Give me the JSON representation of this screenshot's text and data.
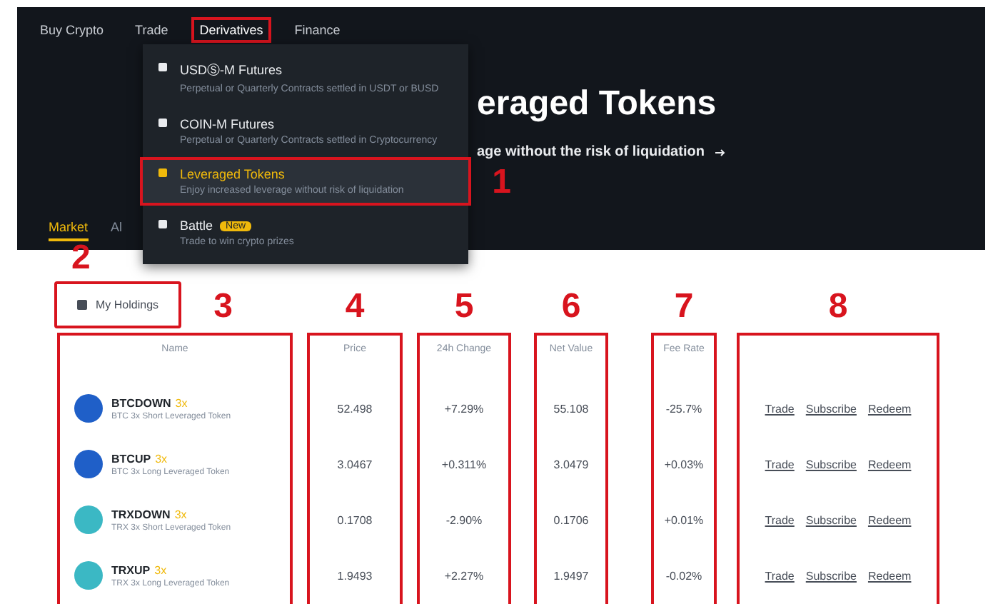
{
  "nav": {
    "items": [
      {
        "label": "Buy Crypto",
        "highlighted": false
      },
      {
        "label": "Trade",
        "highlighted": false
      },
      {
        "label": "Derivatives",
        "highlighted": true
      },
      {
        "label": "Finance",
        "highlighted": false
      }
    ]
  },
  "derivatives_menu": {
    "items": [
      {
        "title": "USDⓈ-M Futures",
        "description": "Perpetual or Quarterly Contracts settled in USDT or BUSD",
        "selected": false
      },
      {
        "title": "COIN-M Futures",
        "description": "Perpetual or Quarterly Contracts settled in Cryptocurrency",
        "selected": false
      },
      {
        "title": "Leveraged Tokens",
        "description": "Enjoy increased leverage without risk of liquidation",
        "selected": true,
        "annotation": "1"
      },
      {
        "title": "Battle",
        "description": "Trade to win crypto prizes",
        "selected": false,
        "badge": "New"
      }
    ]
  },
  "hero": {
    "title": "eraged Tokens",
    "subtitle": "age without the risk of liquidation"
  },
  "tabs": [
    {
      "label": "Market",
      "selected": true
    },
    {
      "label": "Al",
      "selected": false
    }
  ],
  "holdings_button": {
    "label": "My Holdings",
    "annotation": "2"
  },
  "token_table": {
    "sections": [
      {
        "header": "Name",
        "annotation": "3"
      },
      {
        "header": "Price",
        "annotation": "4"
      },
      {
        "header": "24h Change",
        "annotation": "5"
      },
      {
        "header": "Net Value",
        "annotation": "6"
      },
      {
        "header": "Fee Rate",
        "annotation": "7"
      },
      {
        "annotation": "8"
      }
    ],
    "tokens": [
      {
        "name": "BTCDOWN",
        "badge": "3x",
        "description": "BTC 3x Short Leveraged Token",
        "color": "#1f5fc8",
        "price": "52.498",
        "change": "+7.29%",
        "net_value": "55.108",
        "fee_rate": "-25.7%",
        "actions": [
          "Trade",
          "Subscribe",
          "Redeem"
        ]
      },
      {
        "name": "BTCUP",
        "badge": "3x",
        "description": "BTC 3x Long Leveraged Token",
        "color": "#1f5fc8",
        "price": "3.0467",
        "change": "+0.311%",
        "net_value": "3.0479",
        "fee_rate": "+0.03%",
        "actions": [
          "Trade",
          "Subscribe",
          "Redeem"
        ]
      },
      {
        "name": "TRXDOWN",
        "badge": "3x",
        "description": "TRX 3x Short Leveraged Token",
        "color": "#3bb8c4",
        "price": "0.1708",
        "change": "-2.90%",
        "net_value": "0.1706",
        "fee_rate": "+0.01%",
        "actions": [
          "Trade",
          "Subscribe",
          "Redeem"
        ]
      },
      {
        "name": "TRXUP",
        "badge": "3x",
        "description": "TRX 3x Long Leveraged Token",
        "color": "#3bb8c4",
        "price": "1.9493",
        "change": "+2.27%",
        "net_value": "1.9497",
        "fee_rate": "-0.02%",
        "actions": [
          "Trade",
          "Subscribe",
          "Redeem"
        ]
      }
    ]
  }
}
